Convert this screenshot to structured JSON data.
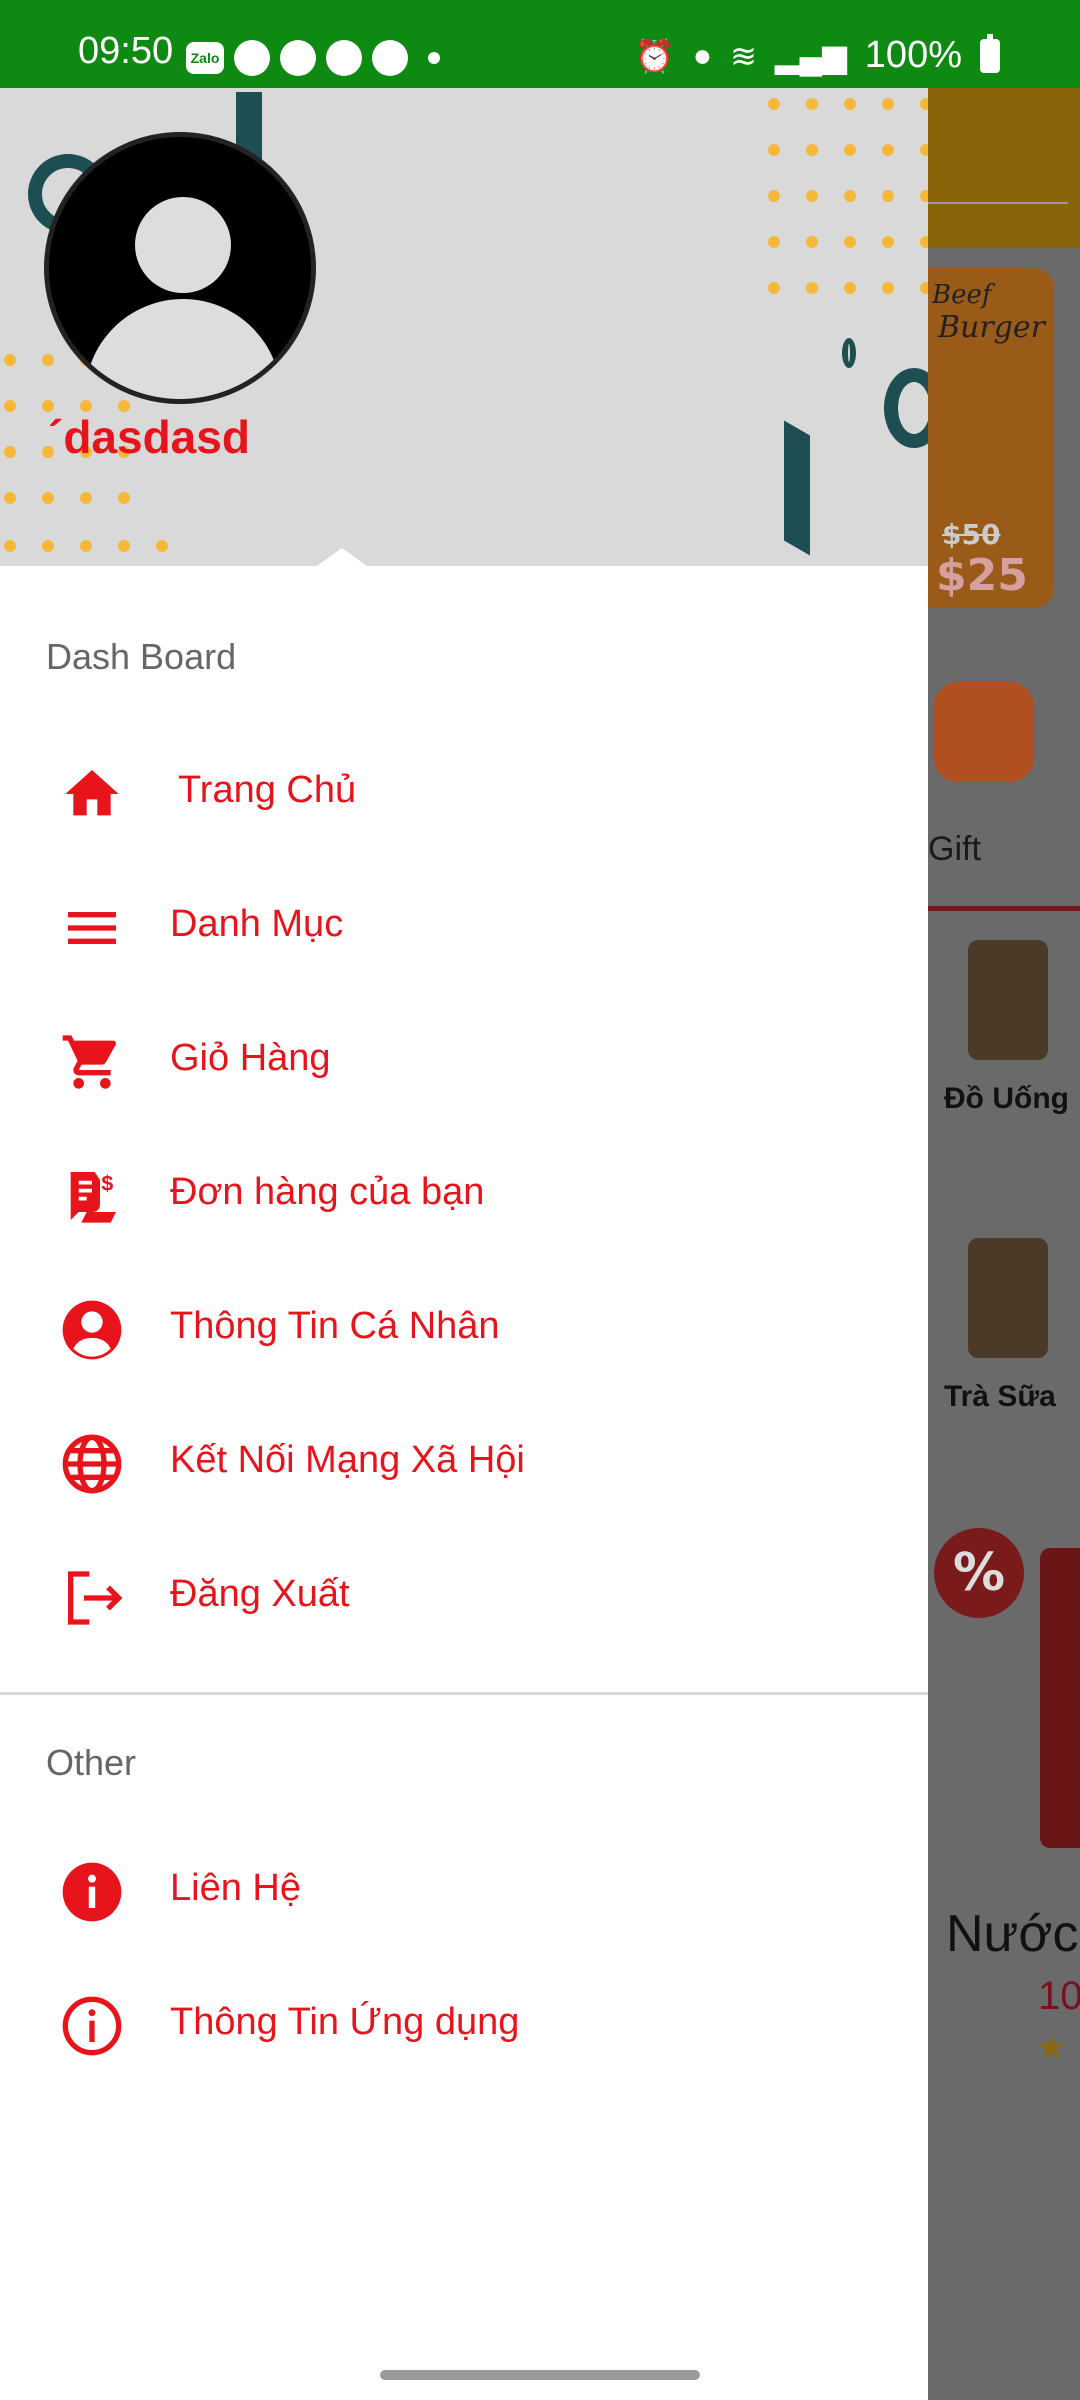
{
  "status_bar": {
    "time": "09:50",
    "zalo_label": "Zalo",
    "battery": "100%",
    "color": "#0e8a12"
  },
  "drawer": {
    "username": "´dasdasd",
    "sections": {
      "dashboard_title": "Dash Board",
      "other_title": "Other"
    },
    "items": [
      {
        "label": "Trang Chủ",
        "icon": "home-icon"
      },
      {
        "label": "Danh Mục",
        "icon": "menu-list-icon"
      },
      {
        "label": "Giỏ Hàng",
        "icon": "cart-icon"
      },
      {
        "label": "Đơn hàng của bạn",
        "icon": "receipt-icon"
      },
      {
        "label": "Thông Tin Cá Nhân",
        "icon": "account-circle-icon"
      },
      {
        "label": "Kết Nối Mạng Xã Hội",
        "icon": "globe-icon"
      },
      {
        "label": "Đăng Xuất",
        "icon": "logout-icon"
      }
    ],
    "other_items": [
      {
        "label": "Liên Hệ",
        "icon": "info-filled-icon"
      },
      {
        "label": "Thông Tin Ứng dụng",
        "icon": "info-outline-icon"
      }
    ],
    "accent_color": "#e8141c"
  },
  "background_app": {
    "banner_title_1": "Beef",
    "banner_title_2": "Burger",
    "banner_old_price": "$50",
    "banner_new_price": "$25",
    "gift_label": "Gift",
    "categories": [
      "Đồ Uống",
      "Trà Sữa"
    ],
    "discount_badge": "%",
    "product_name": "Nước",
    "product_price": "10",
    "star": "★"
  }
}
